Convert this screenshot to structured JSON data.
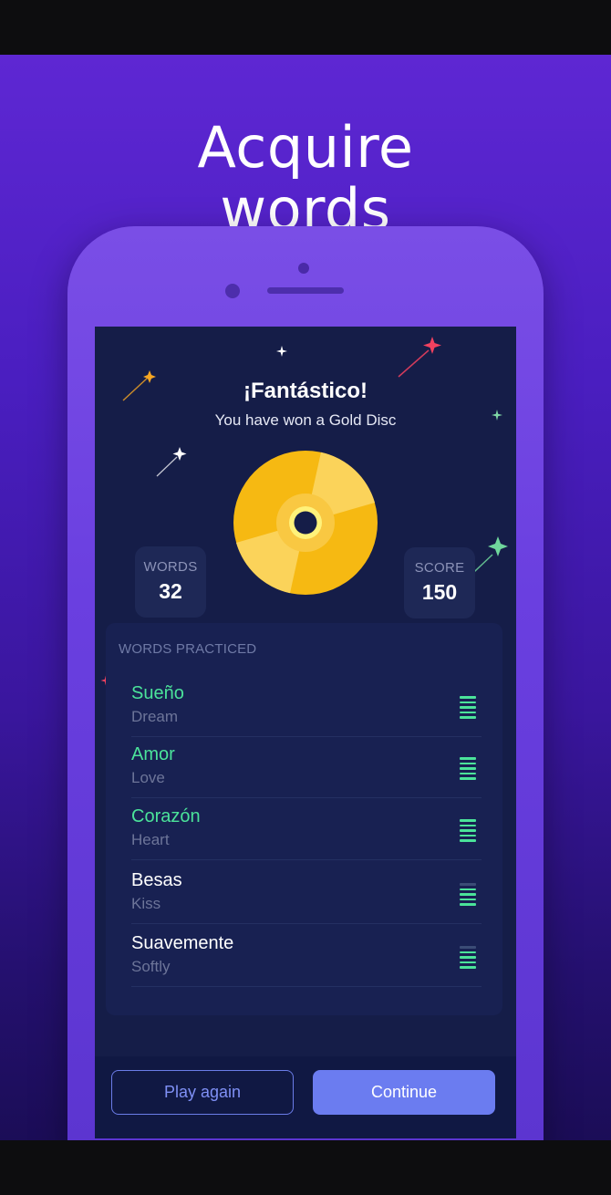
{
  "headline": [
    "Acquire",
    "words"
  ],
  "result": {
    "title": "¡Fantástico!",
    "subtitle": "You have won a Gold Disc",
    "words_label": "WORDS",
    "words_value": "32",
    "score_label": "SCORE",
    "score_value": "150",
    "award_icon": "gold-disc-icon"
  },
  "practiced": {
    "title": "WORDS PRACTICED",
    "items": [
      {
        "word": "Sueño",
        "translation": "Dream",
        "mastered": true,
        "strength_bars": 5,
        "max_bars": 5
      },
      {
        "word": "Amor",
        "translation": "Love",
        "mastered": true,
        "strength_bars": 5,
        "max_bars": 5
      },
      {
        "word": "Corazón",
        "translation": "Heart",
        "mastered": true,
        "strength_bars": 5,
        "max_bars": 5
      },
      {
        "word": "Besas",
        "translation": "Kiss",
        "mastered": false,
        "strength_bars": 4,
        "max_bars": 5
      },
      {
        "word": "Suavemente",
        "translation": "Softly",
        "mastered": false,
        "strength_bars": 4,
        "max_bars": 5
      }
    ]
  },
  "buttons": {
    "play_again": "Play again",
    "continue": "Continue"
  },
  "colors": {
    "mastered_word": "#4be39a",
    "default_word": "#ffffff",
    "gold": "#f6b912",
    "accent": "#6b7cf0"
  }
}
